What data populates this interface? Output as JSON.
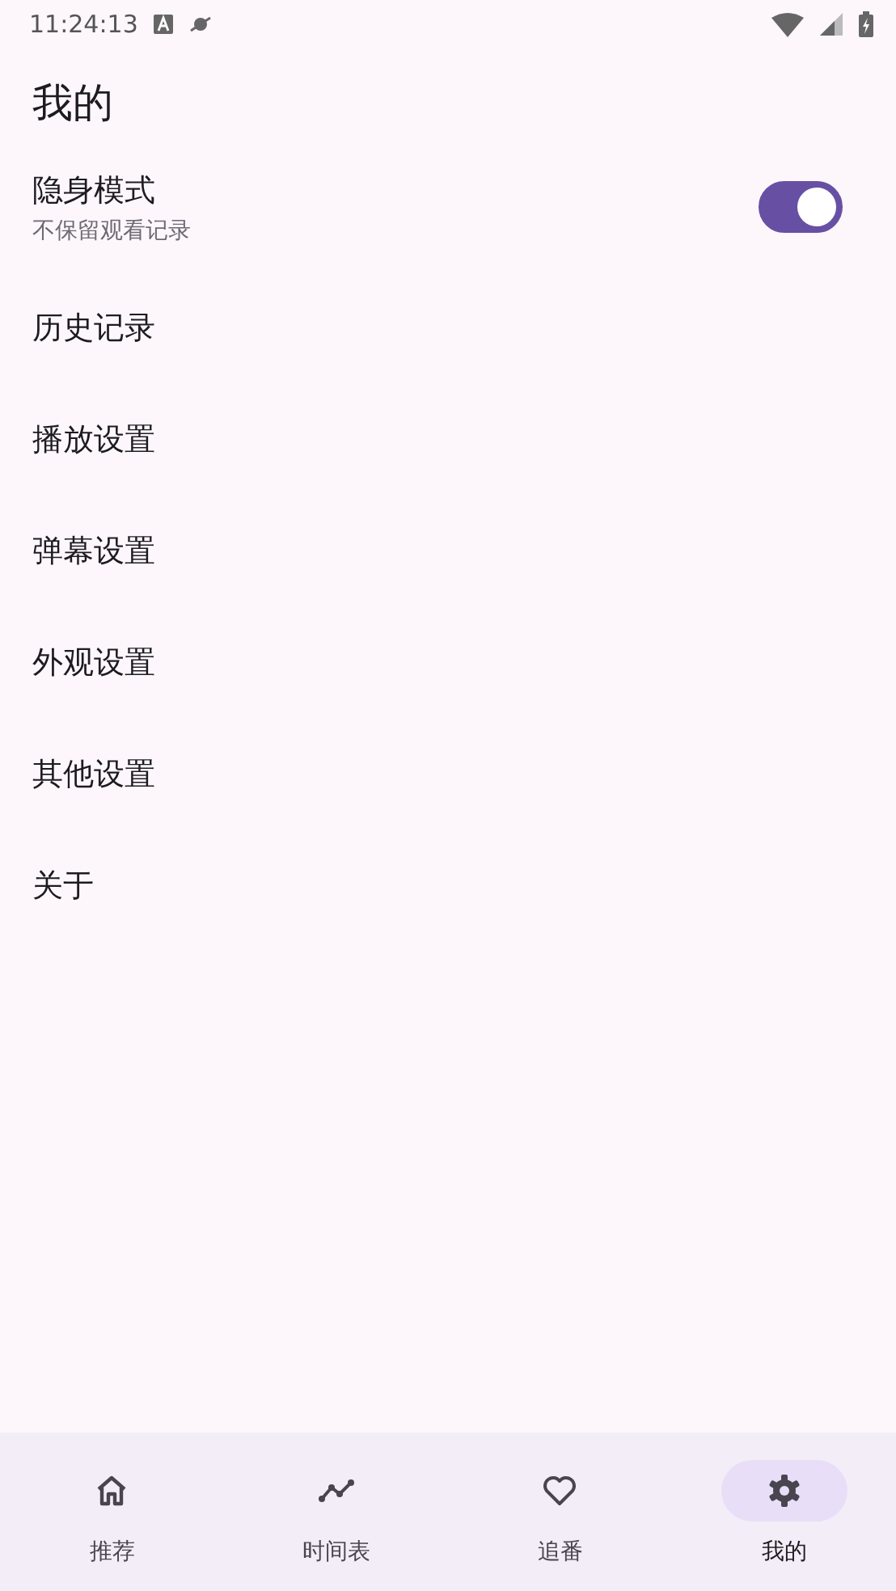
{
  "status_bar": {
    "time": "11:24:13"
  },
  "title": "我的",
  "incognito": {
    "label": "隐身模式",
    "description": "不保留观看记录",
    "on": true
  },
  "menu_items": [
    {
      "label": "历史记录"
    },
    {
      "label": "播放设置"
    },
    {
      "label": "弹幕设置"
    },
    {
      "label": "外观设置"
    },
    {
      "label": "其他设置"
    },
    {
      "label": "关于"
    }
  ],
  "bottom_nav": [
    {
      "label": "推荐",
      "selected": false
    },
    {
      "label": "时间表",
      "selected": false
    },
    {
      "label": "追番",
      "selected": false
    },
    {
      "label": "我的",
      "selected": true
    }
  ]
}
